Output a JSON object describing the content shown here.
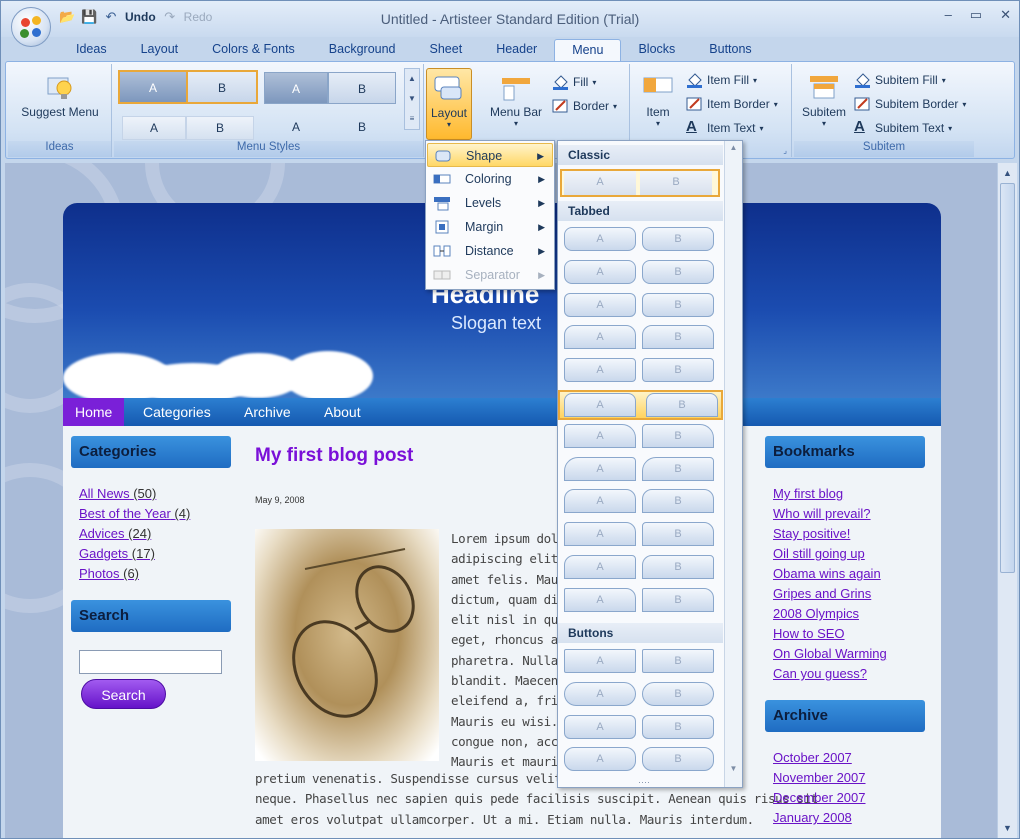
{
  "window": {
    "title": "Untitled - Artisteer Standard Edition (Trial)",
    "controls": [
      "–",
      "▭",
      "✕"
    ]
  },
  "qat": {
    "undo": "Undo",
    "redo": "Redo"
  },
  "tabs": [
    "Ideas",
    "Layout",
    "Colors & Fonts",
    "Background",
    "Sheet",
    "Header",
    "Menu",
    "Blocks",
    "Buttons"
  ],
  "active_tab": "Menu",
  "ribbon": {
    "ideas": {
      "suggest": "Suggest Menu",
      "caption": "Ideas"
    },
    "menu_styles": {
      "caption": "Menu Styles",
      "a": "A",
      "b": "B"
    },
    "layout": {
      "label": "Layout"
    },
    "menubar": {
      "label": "Menu Bar",
      "fill": "Fill",
      "border": "Border"
    },
    "item": {
      "label": "Item",
      "fill": "Item Fill",
      "border": "Item Border",
      "text": "Item Text"
    },
    "subitem": {
      "label": "Subitem",
      "fill": "Subitem Fill",
      "border": "Subitem Border",
      "text": "Subitem Text",
      "caption": "Subitem"
    }
  },
  "layout_menu": {
    "items": [
      {
        "label": "Shape"
      },
      {
        "label": "Coloring"
      },
      {
        "label": "Levels"
      },
      {
        "label": "Margin"
      },
      {
        "label": "Distance"
      },
      {
        "label": "Separator"
      }
    ]
  },
  "gallery": {
    "sections": [
      "Classic",
      "Tabbed",
      "Buttons"
    ],
    "a": "A",
    "b": "B"
  },
  "site": {
    "headline": "Headline",
    "slogan": "Slogan text",
    "nav": [
      "Home",
      "Categories",
      "Archive",
      "About"
    ],
    "categories_title": "Categories",
    "categories": [
      {
        "label": "All News",
        "count": "(50)"
      },
      {
        "label": "Best of the Year",
        "count": "(4)"
      },
      {
        "label": "Advices",
        "count": "(24)"
      },
      {
        "label": "Gadgets",
        "count": "(17)"
      },
      {
        "label": "Photos",
        "count": "(6)"
      }
    ],
    "search_title": "Search",
    "search_button": "Search",
    "post_title": "My first blog post",
    "post_date": "May 9, 2008",
    "post_lines": [
      "Lorem ipsum dolo",
      "adipiscing elit. Qu",
      "amet felis. Mauris",
      "dictum, quam dia",
      "elit nisl in quam.",
      "eget, rhoncus at,",
      "pharetra. Nulla ir",
      "blandit. Maecena",
      "eleifend a, fringil",
      "Mauris eu wisi. U",
      "congue non, acc",
      "Mauris et mauris."
    ],
    "post_full_lines": [
      "pretium venenatis. Suspendisse cursus velit vel lig",
      "neque. Phasellus nec sapien quis pede facilisis suscipit. Aenean quis risus sit",
      "amet eros volutpat ullamcorper. Ut a mi. Etiam nulla. Mauris interdum."
    ],
    "bookmarks_title": "Bookmarks",
    "bookmarks": [
      "My first blog",
      "Who will prevail?",
      "Stay positive!",
      "Oil still going up",
      "Obama wins again",
      "Gripes and Grins",
      "2008 Olympics",
      "How to SEO",
      "On Global Warming",
      "Can you guess?"
    ],
    "archive_title": "Archive",
    "archive": [
      "October 2007",
      "November 2007",
      "December 2007",
      "January 2008"
    ]
  }
}
